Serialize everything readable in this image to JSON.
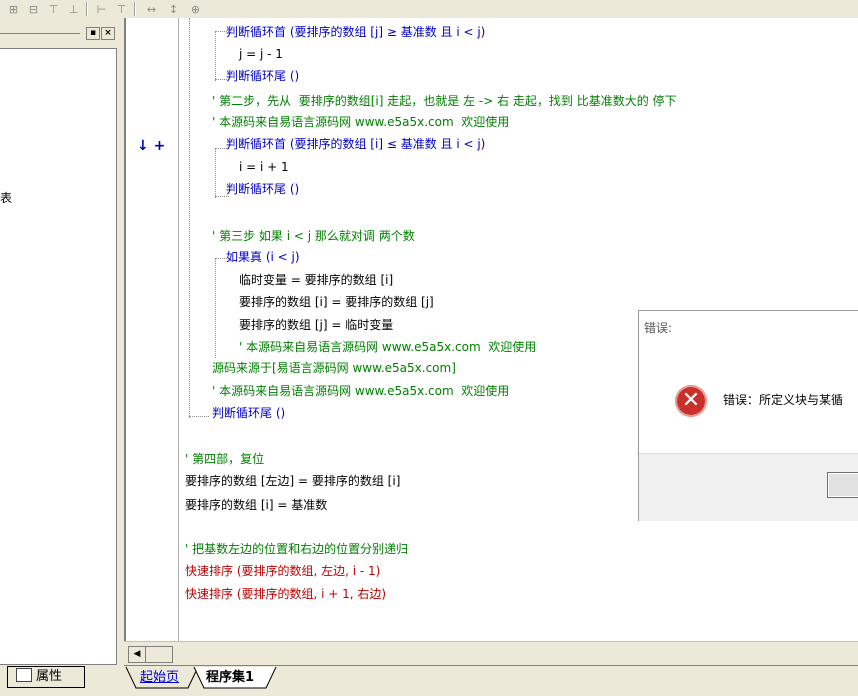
{
  "left_panel": {
    "cut_glyph": "表",
    "tab_label": "属性"
  },
  "editor": {
    "lines": [
      {
        "text": "判断循环首 (要排序的数组 [j] ≥ 基准数 且 i < j)",
        "color": "blue"
      },
      {
        "text": "j = j - 1",
        "color": "black"
      },
      {
        "text": "判断循环尾 ()",
        "color": "blue"
      },
      {
        "text": "' 第二步，先从  要排序的数组[i] 走起，也就是 左 -> 右 走起，找到 比基准数大的 停下",
        "color": "green"
      },
      {
        "text": "' 本源码来自易语言源码网 www.e5a5x.com  欢迎使用",
        "color": "green"
      },
      {
        "text": "判断循环首 (要排序的数组 [i] ≤ 基准数 且 i < j)",
        "color": "blue"
      },
      {
        "text": "i = i + 1",
        "color": "black"
      },
      {
        "text": "判断循环尾 ()",
        "color": "blue"
      },
      {
        "text": "' 第三步 如果 i < j 那么就对调 两个数",
        "color": "green"
      },
      {
        "text": "如果真 (i < j)",
        "color": "blue"
      },
      {
        "text": "临时变量 = 要排序的数组 [i]",
        "color": "black"
      },
      {
        "text": "要排序的数组 [i] = 要排序的数组 [j]",
        "color": "black"
      },
      {
        "text": "要排序的数组 [j] = 临时变量",
        "color": "black"
      },
      {
        "text": "' 本源码来自易语言源码网 www.e5a5x.com  欢迎使用",
        "color": "green"
      },
      {
        "text": "源码来源于[易语言源码网 www.e5a5x.com]",
        "color": "green"
      },
      {
        "text": "' 本源码来自易语言源码网 www.e5a5x.com  欢迎使用",
        "color": "green"
      },
      {
        "text": "判断循环尾 ()",
        "color": "blue"
      },
      {
        "text": "' 第四部，复位",
        "color": "green"
      },
      {
        "text": "要排序的数组 [左边] = 要排序的数组 [i]",
        "color": "black"
      },
      {
        "text": "要排序的数组 [i] = 基准数",
        "color": "black"
      },
      {
        "text": "' 把基数左边的位置和右边的位置分别递归",
        "color": "green"
      },
      {
        "text": "快速排序 (要排序的数组, 左边, i - 1)",
        "color": "red"
      },
      {
        "text": "快速排序 (要排序的数组, i + 1, 右边)",
        "color": "red"
      }
    ],
    "gutter_arrows": "↓ +"
  },
  "tabs": {
    "start_page": "起始页",
    "program_set": "程序集1"
  },
  "dialog": {
    "title": "错误:",
    "message": "错误：所定义块与某循",
    "icon": "error-icon"
  }
}
